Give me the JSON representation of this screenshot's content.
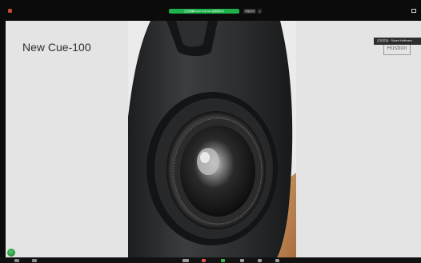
{
  "topbar": {
    "share_banner_text": "正在观看Robert Hoffmann的屏幕共享",
    "view_options_label": "视图选项",
    "view_options_caret": "⌄"
  },
  "slide": {
    "title": "New Cue-100",
    "logo_text": "Hüsbon",
    "speaker_badge": "正在讲话：Robert Hoffmann"
  },
  "colors": {
    "share_banner": "#1eb04b",
    "slide_background": "#e4e4e4",
    "speaker_body": "#2e3033",
    "wood_accent": "#c48a57",
    "window_chrome": "#0b0b0b",
    "mic_active": "#2c9c46"
  },
  "icons": {
    "app": "app-logo-icon",
    "fullscreen": "fullscreen-icon",
    "microphone": "microphone-icon"
  }
}
